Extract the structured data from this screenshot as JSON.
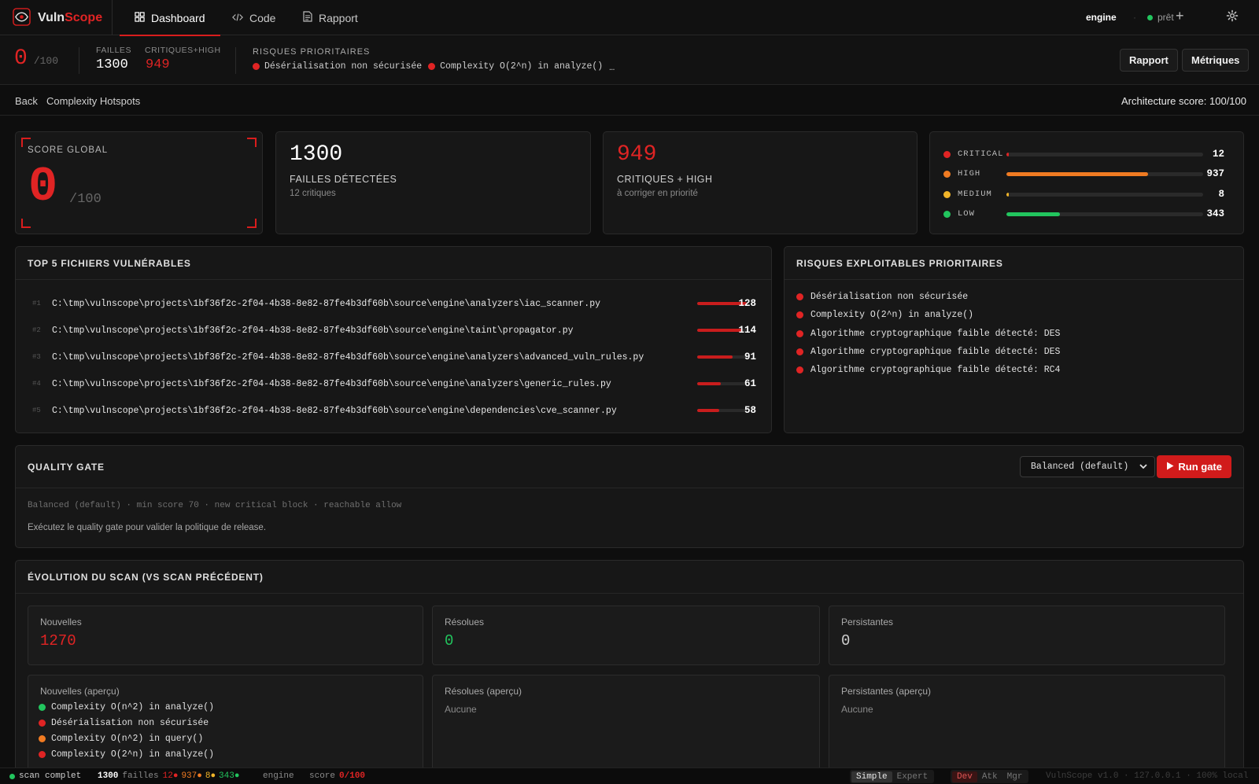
{
  "app": {
    "brand_a": "Vuln",
    "brand_b": "Scope",
    "tabs": [
      {
        "label": "Dashboard"
      },
      {
        "label": "Code"
      },
      {
        "label": "Rapport"
      }
    ],
    "engine": "engine",
    "status": "prêt",
    "plus": "+"
  },
  "summary": {
    "score": "0",
    "score_of": "/100",
    "failles_label": "FAILLES",
    "failles_value": "1300",
    "crit_label": "CRITIQUES+HIGH",
    "crit_value": "949",
    "risks_title": "RISQUES PRIORITAIRES",
    "risks": [
      "Désérialisation non sécurisée",
      "Complexity O(2^n) in analyze()",
      "Algorithme cryptographique faible détecté: DES"
    ],
    "btn_rapport": "Rapport",
    "btn_metriques": "Métriques"
  },
  "breadcrumb": {
    "back": "Back",
    "current": "Complexity Hotspots",
    "arch": "Architecture score: 100/100"
  },
  "score_card": {
    "label": "SCORE GLOBAL",
    "value": "0",
    "of": "/100"
  },
  "kpi_failles": {
    "value": "1300",
    "label": "FAILLES DÉTECTÉES",
    "sub": "12 critiques"
  },
  "kpi_crit": {
    "value": "949",
    "label": "CRITIQUES + HIGH",
    "sub": "à corriger en priorité"
  },
  "severity": [
    {
      "name": "CRITICAL",
      "count": "12",
      "color": "#e02424",
      "pct": 1.3
    },
    {
      "name": "HIGH",
      "count": "937",
      "color": "#f07b22",
      "pct": 72
    },
    {
      "name": "MEDIUM",
      "count": "8",
      "color": "#f0b429",
      "pct": 0.8
    },
    {
      "name": "LOW",
      "count": "343",
      "color": "#22c55e",
      "pct": 27
    }
  ],
  "top_files": {
    "title": "TOP 5 FICHIERS VULNÉRABLES",
    "items": [
      {
        "idx": "#1",
        "path": "C:\\tmp\\vulnscope\\projects\\1bf36f2c-2f04-4b38-8e82-87fe4b3df60b\\source\\engine\\analyzers\\iac_scanner.py",
        "count": "128",
        "pct": 100
      },
      {
        "idx": "#2",
        "path": "C:\\tmp\\vulnscope\\projects\\1bf36f2c-2f04-4b38-8e82-87fe4b3df60b\\source\\engine\\taint\\propagator.py",
        "count": "114",
        "pct": 89
      },
      {
        "idx": "#3",
        "path": "C:\\tmp\\vulnscope\\projects\\1bf36f2c-2f04-4b38-8e82-87fe4b3df60b\\source\\engine\\analyzers\\advanced_vuln_rules.py",
        "count": "91",
        "pct": 71
      },
      {
        "idx": "#4",
        "path": "C:\\tmp\\vulnscope\\projects\\1bf36f2c-2f04-4b38-8e82-87fe4b3df60b\\source\\engine\\analyzers\\generic_rules.py",
        "count": "61",
        "pct": 48
      },
      {
        "idx": "#5",
        "path": "C:\\tmp\\vulnscope\\projects\\1bf36f2c-2f04-4b38-8e82-87fe4b3df60b\\source\\engine\\dependencies\\cve_scanner.py",
        "count": "58",
        "pct": 45
      }
    ]
  },
  "risks_card": {
    "title": "RISQUES EXPLOITABLES PRIORITAIRES",
    "items": [
      "Désérialisation non sécurisée",
      "Complexity O(2^n) in analyze()",
      "Algorithme cryptographique faible détecté: DES",
      "Algorithme cryptographique faible détecté: DES",
      "Algorithme cryptographique faible détecté: RC4"
    ]
  },
  "quality_gate": {
    "title": "QUALITY GATE",
    "select": "Balanced (default)",
    "run": "Run gate",
    "policy": "Balanced (default) · min score 70 · new critical block · reachable allow",
    "hint": "Exécutez le quality gate pour valider la politique de release."
  },
  "evolution": {
    "title": "ÉVOLUTION DU SCAN (VS SCAN PRÉCÉDENT)",
    "nouvelles_label": "Nouvelles",
    "nouvelles": "1270",
    "resolues_label": "Résolues",
    "resolues": "0",
    "persistantes_label": "Persistantes",
    "persistantes": "0",
    "prev_new_label": "Nouvelles (aperçu)",
    "prev_new": [
      {
        "text": "Complexity O(n^2) in analyze()",
        "color": "#22c55e"
      },
      {
        "text": "Désérialisation non sécurisée",
        "color": "#e02424"
      },
      {
        "text": "Complexity O(n^2) in query()",
        "color": "#f07b22"
      },
      {
        "text": "Complexity O(2^n) in analyze()",
        "color": "#e02424"
      }
    ],
    "prev_res_label": "Résolues (aperçu)",
    "prev_res_empty": "Aucune",
    "prev_per_label": "Persistantes (aperçu)",
    "prev_per_empty": "Aucune"
  },
  "statusbar": {
    "scan": "scan complet",
    "count": "1300",
    "failles": "failles",
    "crit": "12●",
    "high": "937●",
    "med": "8●",
    "low": "343●",
    "engine": "engine",
    "score_label": "score",
    "score": "0/100",
    "mode_simple": "Simple",
    "mode_expert": "Expert",
    "role_dev": "Dev",
    "role_atk": "Atk",
    "role_mgr": "Mgr",
    "version": "VulnScope v1.0 · 127.0.0.1 · 100% local"
  },
  "colors": {
    "accent": "#e02424",
    "high": "#f07b22",
    "medium": "#f0b429",
    "low": "#22c55e",
    "bg": "#0e0e0e"
  }
}
